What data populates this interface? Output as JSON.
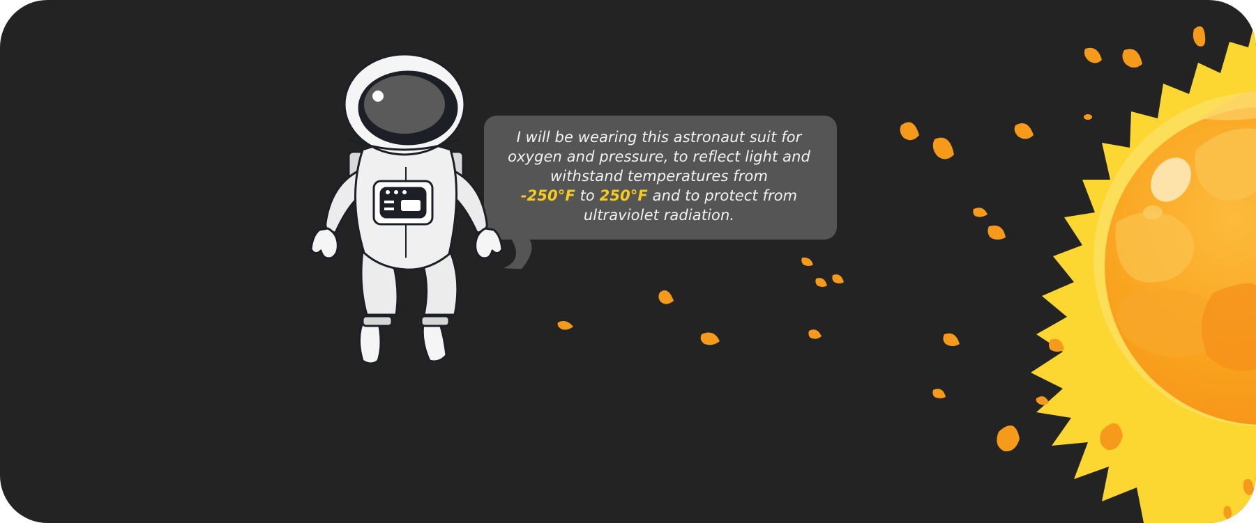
{
  "speech_bubble": {
    "line1": "I will be wearing this astronaut suit for",
    "line2": "oxygen and pressure, to reflect light and",
    "line3": "withstand temperatures from",
    "temp_low": "-250°F",
    "connector": " to ",
    "temp_high": "250°F",
    "line4_rest": " and to protect from",
    "line5": "ultraviolet radiation."
  },
  "colors": {
    "panel_background": "#232323",
    "bubble_background": "#555555",
    "bubble_text": "#f2f2f2",
    "highlight": "#f7cc1f",
    "sun_yellow": "#fcd732",
    "sun_orange": "#f9a825",
    "ember_orange": "#f59a1b"
  },
  "icons": {
    "character": "astronaut-illustration",
    "sun": "sun-illustration"
  }
}
